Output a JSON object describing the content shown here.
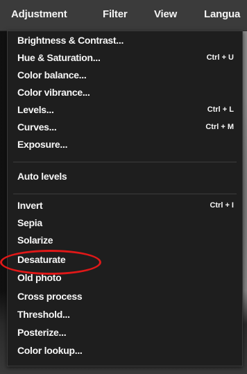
{
  "menubar": {
    "items": [
      {
        "label": "Adjustment"
      },
      {
        "label": "Filter"
      },
      {
        "label": "View"
      },
      {
        "label": "Langua"
      }
    ]
  },
  "dropdown": {
    "items": [
      {
        "label": "Brightness & Contrast...",
        "shortcut": ""
      },
      {
        "label": "Hue & Saturation...",
        "shortcut": "Ctrl + U"
      },
      {
        "label": "Color balance...",
        "shortcut": ""
      },
      {
        "label": "Color vibrance...",
        "shortcut": ""
      },
      {
        "label": "Levels...",
        "shortcut": "Ctrl + L"
      },
      {
        "label": "Curves...",
        "shortcut": "Ctrl + M"
      },
      {
        "label": "Exposure...",
        "shortcut": ""
      },
      {
        "label": "Auto levels",
        "shortcut": ""
      },
      {
        "label": "Invert",
        "shortcut": "Ctrl + I"
      },
      {
        "label": "Sepia",
        "shortcut": ""
      },
      {
        "label": "Solarize",
        "shortcut": ""
      },
      {
        "label": "Desaturate",
        "shortcut": ""
      },
      {
        "label": "Old photo",
        "shortcut": ""
      },
      {
        "label": "Cross process",
        "shortcut": ""
      },
      {
        "label": "Threshold...",
        "shortcut": ""
      },
      {
        "label": "Posterize...",
        "shortcut": ""
      },
      {
        "label": "Color lookup...",
        "shortcut": ""
      }
    ]
  },
  "colors": {
    "highlight": "#e01818",
    "menu_bg": "#1e1e1e",
    "menubar_bg": "#3b3b3b"
  }
}
